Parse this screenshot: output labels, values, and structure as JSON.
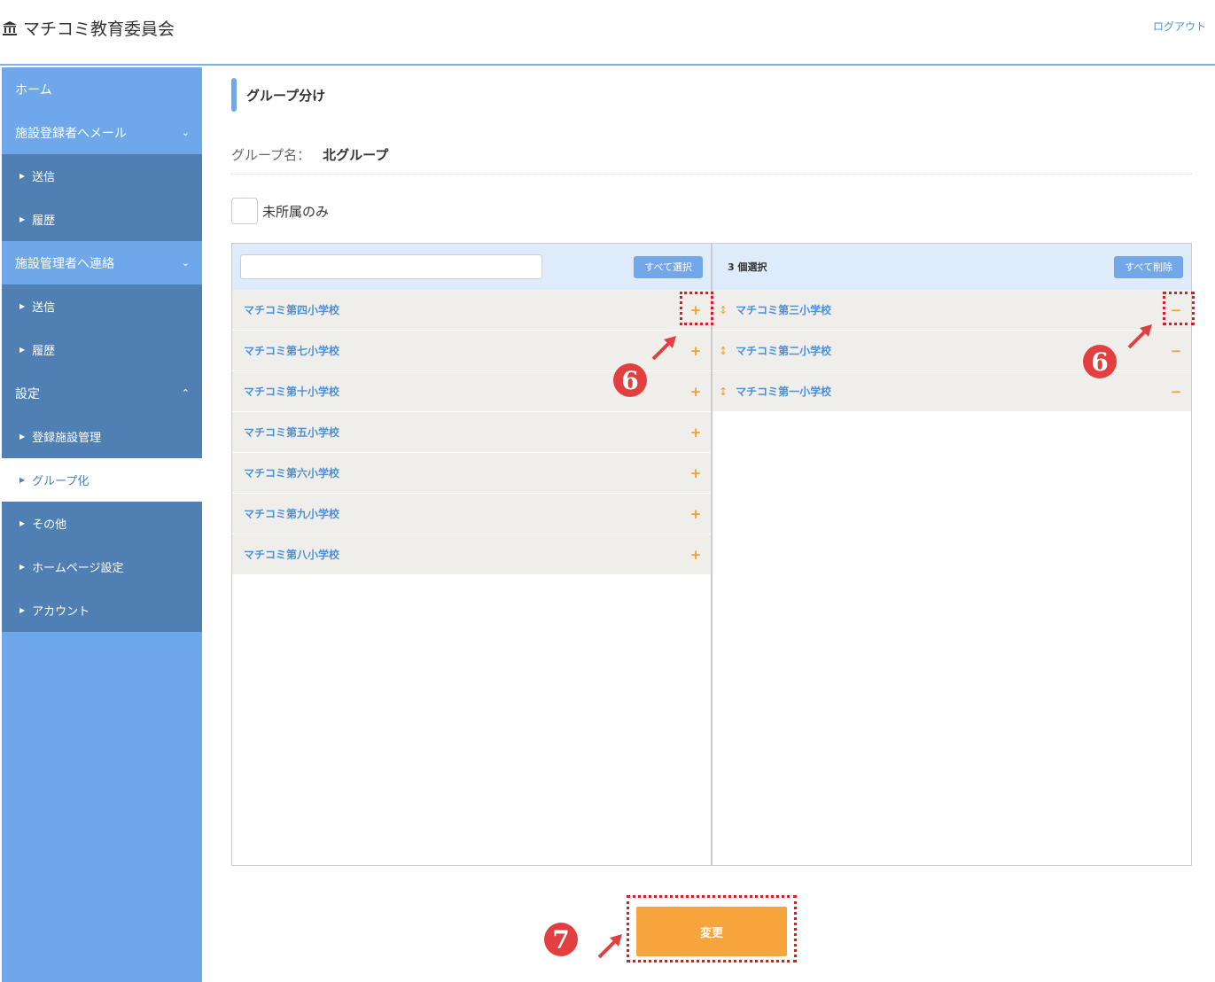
{
  "header": {
    "brand_icon": "bank-building-icon",
    "brand_title": "マチコミ教育委員会",
    "logout_label": "ログアウト"
  },
  "sidebar": {
    "items": [
      {
        "label": "ホーム"
      },
      {
        "label": "施設登録者へメール",
        "chevron": "⌄"
      },
      {
        "label": "送信"
      },
      {
        "label": "履歴"
      },
      {
        "label": "施設管理者へ連絡",
        "chevron": "⌄"
      },
      {
        "label": "送信"
      },
      {
        "label": "履歴"
      },
      {
        "label": "設定",
        "chevron": "⌃"
      },
      {
        "label": "登録施設管理"
      },
      {
        "label": "グループ化"
      },
      {
        "label": "その他"
      },
      {
        "label": "ホームページ設定"
      },
      {
        "label": "アカウント"
      }
    ]
  },
  "main": {
    "page_title": "グループ分け",
    "group_label": "グループ名：",
    "group_value": "北グループ",
    "unassigned_only_label": "未所属のみ",
    "left_panel": {
      "search_placeholder": "",
      "select_all_label": "すべて選択",
      "items": [
        "マチコミ第四小学校",
        "マチコミ第七小学校",
        "マチコミ第十小学校",
        "マチコミ第五小学校",
        "マチコミ第六小学校",
        "マチコミ第九小学校",
        "マチコミ第八小学校"
      ],
      "add_symbol": "+"
    },
    "right_panel": {
      "selected_count": "3 個選択",
      "remove_all_label": "すべて削除",
      "items": [
        "マチコミ第三小学校",
        "マチコミ第二小学校",
        "マチコミ第一小学校"
      ],
      "remove_symbol": "−",
      "drag_symbol": "↕"
    },
    "submit_label": "変更"
  },
  "annotations": {
    "step6": "6",
    "step7": "7"
  },
  "colors": {
    "sidebar_bg": "#6ea8ea",
    "sidebar_sub_bg": "#4f7fb3",
    "accent_orange": "#f5a53b",
    "link_blue": "#4a90d9",
    "annotation_red": "#d0202a"
  }
}
